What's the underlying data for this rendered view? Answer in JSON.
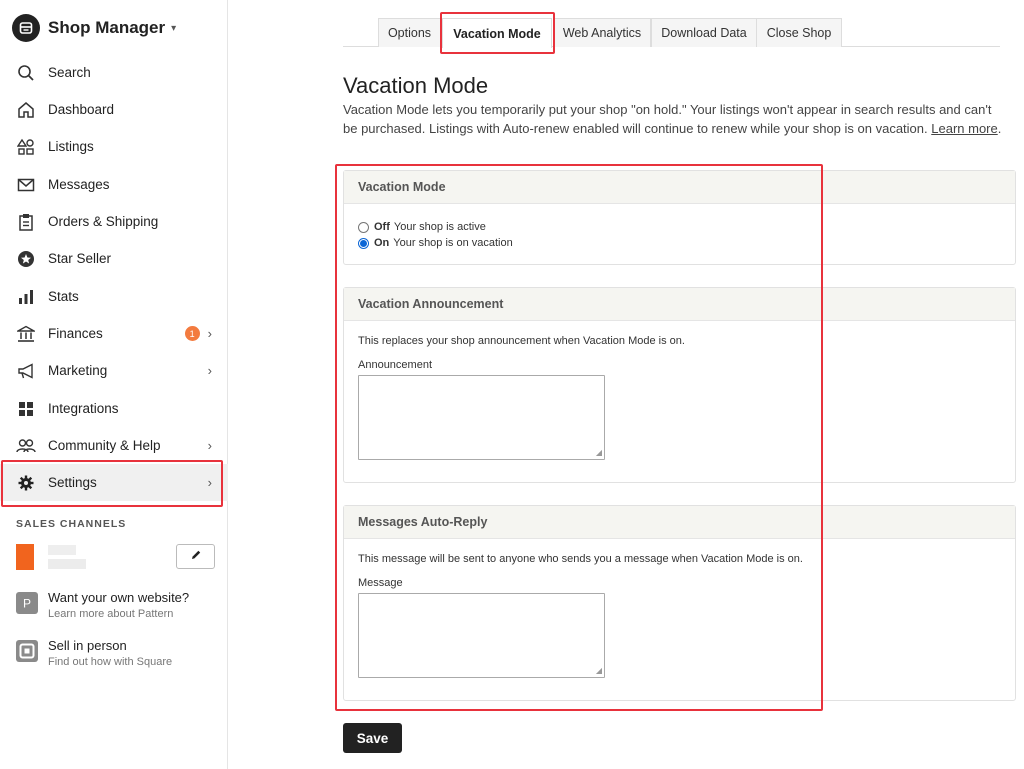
{
  "app": {
    "title": "Shop Manager",
    "caret": "▾"
  },
  "sidebar": {
    "items": [
      {
        "label": "Search",
        "icon": "search-icon"
      },
      {
        "label": "Dashboard",
        "icon": "home-icon"
      },
      {
        "label": "Listings",
        "icon": "shapes-icon"
      },
      {
        "label": "Messages",
        "icon": "mail-icon"
      },
      {
        "label": "Orders & Shipping",
        "icon": "clipboard-icon"
      },
      {
        "label": "Star Seller",
        "icon": "star-badge-icon"
      },
      {
        "label": "Stats",
        "icon": "bar-chart-icon"
      },
      {
        "label": "Finances",
        "icon": "bank-icon",
        "badge": "1",
        "chevron": "›"
      },
      {
        "label": "Marketing",
        "icon": "megaphone-icon",
        "chevron": "›"
      },
      {
        "label": "Integrations",
        "icon": "grid-icon"
      },
      {
        "label": "Community & Help",
        "icon": "people-icon",
        "chevron": "›"
      },
      {
        "label": "Settings",
        "icon": "gear-icon",
        "chevron": "›"
      }
    ],
    "sales_channels_header": "SALES CHANNELS",
    "promos": [
      {
        "title": "Want your own website?",
        "subtitle": "Learn more about Pattern",
        "icon_letter": "P"
      },
      {
        "title": "Sell in person",
        "subtitle": "Find out how with Square"
      }
    ]
  },
  "tabs": [
    {
      "label": "Options"
    },
    {
      "label": "Vacation Mode"
    },
    {
      "label": "Web Analytics"
    },
    {
      "label": "Download Data"
    },
    {
      "label": "Close Shop"
    }
  ],
  "page": {
    "title": "Vacation Mode",
    "description": "Vacation Mode lets you temporarily put your shop \"on hold.\" Your listings won't appear in search results and can't be purchased. Listings with Auto-renew enabled will continue to renew while your shop is on vacation.",
    "learn_more": "Learn more",
    "period": "."
  },
  "vacation_panel": {
    "title": "Vacation Mode",
    "options": [
      {
        "strong": "Off",
        "text": "Your shop is active",
        "checked": false
      },
      {
        "strong": "On",
        "text": "Your shop is on vacation",
        "checked": true
      }
    ]
  },
  "announcement_panel": {
    "title": "Vacation Announcement",
    "description": "This replaces your shop announcement when Vacation Mode is on.",
    "field_label": "Announcement",
    "value": ""
  },
  "autoreply_panel": {
    "title": "Messages Auto-Reply",
    "description": "This message will be sent to anyone who sends you a message when Vacation Mode is on.",
    "field_label": "Message",
    "value": ""
  },
  "save_label": "Save",
  "colors": {
    "accent_orange": "#f1641e",
    "highlight_red": "#e8323c",
    "radio_blue": "#0b66d6"
  }
}
